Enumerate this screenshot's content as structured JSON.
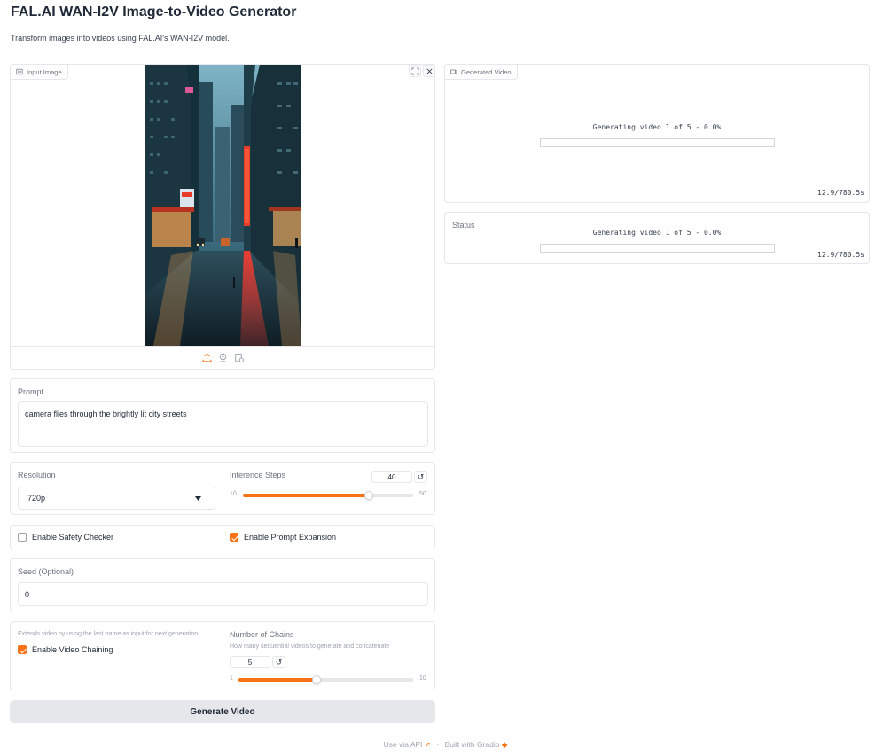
{
  "header": {
    "title": "FAL.AI WAN-I2V Image-to-Video Generator",
    "subtitle": "Transform images into videos using FAL.AI's WAN-I2V model."
  },
  "input_image": {
    "label": "Input Image",
    "icons": [
      "image-icon",
      "fullscreen-icon",
      "close-icon",
      "upload-icon",
      "webcam-icon",
      "clipboard-icon"
    ]
  },
  "generated_video": {
    "label": "Generated Video",
    "progress_text": "Generating video 1 of 5 - 0.0%",
    "progress_fraction": 0.0,
    "timer": "12.9/780.5s"
  },
  "status": {
    "label": "Status",
    "progress_text": "Generating video 1 of 5 - 0.0%",
    "progress_fraction": 0.0,
    "timer": "12.9/780.5s"
  },
  "prompt": {
    "label": "Prompt",
    "value": "camera flies through the brightly lit city streets"
  },
  "resolution": {
    "label": "Resolution",
    "value": "720p"
  },
  "inference_steps": {
    "label": "Inference Steps",
    "value": "40",
    "min": "10",
    "max": "50",
    "reset": "↺"
  },
  "safety_checker": {
    "label": "Enable Safety Checker",
    "checked": false
  },
  "prompt_expansion": {
    "label": "Enable Prompt Expansion",
    "checked": true
  },
  "seed": {
    "label": "Seed (Optional)",
    "value": "0"
  },
  "chaining": {
    "info": "Extends video by using the last frame as input for next generation",
    "label": "Enable Video Chaining",
    "checked": true
  },
  "chains": {
    "label": "Number of Chains",
    "info": "How many sequential videos to generate and concatenate",
    "value": "5",
    "min": "1",
    "max": "10",
    "reset": "↺"
  },
  "generate_button": {
    "label": "Generate Video"
  },
  "footer": {
    "api": "Use via API",
    "separator": "·",
    "built": "Built with Gradio"
  },
  "colors": {
    "accent": "#f97316",
    "border": "#e5e7eb",
    "button_bg": "#e5e7eb"
  }
}
